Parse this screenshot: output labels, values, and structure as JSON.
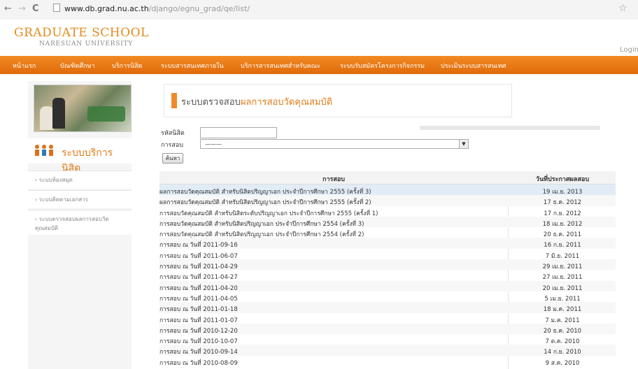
{
  "browser": {
    "url_domain": "www.db.grad.nu.ac.th",
    "url_path": "/django/egnu_grad/qe/list/",
    "back": "←",
    "forward": "→",
    "reload": "C",
    "star": "☆"
  },
  "header": {
    "logo_main": "GRADUATE SCHOOL",
    "logo_sub": "NARESUAN UNIVERSITY",
    "login": "Login"
  },
  "nav": {
    "items": [
      "หน้าแรก",
      "บัณฑิตศึกษา",
      "บริการนิสิต",
      "ระบบสารสนเทศภายใน",
      "บริการสารสนเทศสำหรับคณะ",
      "ระบบรับสมัครโครงการกิจกรรม",
      "ประเมินระบบสารสนเทศ"
    ]
  },
  "sidebar": {
    "service_title": "ระบบบริการนิสิต",
    "links": [
      "ระบบห้องสมุด",
      "ระบบติดตามเอกสาร",
      "ระบบตรวจสอบผลการสอบวัดคุณสมบัติ"
    ]
  },
  "main": {
    "title_prefix": "ระบบตรวจสอบ",
    "title_highlight": "ผลการสอบวัดคุณสมบัติ",
    "student_id_label": "รหัสนิสิต",
    "exam_label": "การสอบ",
    "exam_selected": "———",
    "search_button": "ค้นหา",
    "table_headers": [
      "การสอบ",
      "วันที่ประกาศผลสอบ"
    ],
    "rows": [
      [
        "ผลการสอบวัดคุณสมบัติ สำหรับนิสิตปริญญาเอก ประจำปีการศึกษา 2555 (ครั้งที่ 3)",
        "19 เม.ย. 2013"
      ],
      [
        "ผลการสอบวัดคุณสมบัติ สำหรับนิสิตปริญญาเอก ประจำปีการศึกษา 2555 (ครั้งที่ 2)",
        "17 ธ.ค. 2012"
      ],
      [
        "การสอบวัดคุณสมบัติ สำหรับนิสิตระดับปริญญาเอก ประจำปีการศึกษา 2555 (ครั้งที่ 1)",
        "17 ก.ย. 2012"
      ],
      [
        "การสอบวัดคุณสมบัติ สำหรับนิสิตปริญญาเอก ประจำปีการศึกษา 2554 (ครั้งที่ 3)",
        "18 เม.ย. 2012"
      ],
      [
        "การสอบวัดคุณสมบัติ สำหรับนิสิตปริญญาเอก ประจำปีการศึกษา 2554 (ครั้งที่ 2)",
        "20 ธ.ค. 2011"
      ],
      [
        "การสอบ ณ วันที่ 2011-09-16",
        "16 ก.ย. 2011"
      ],
      [
        "การสอบ ณ วันที่ 2011-06-07",
        "7 มิ.ย. 2011"
      ],
      [
        "การสอบ ณ วันที่ 2011-04-29",
        "29 เม.ย. 2011"
      ],
      [
        "การสอบ ณ วันที่ 2011-04-27",
        "27 เม.ย. 2011"
      ],
      [
        "การสอบ ณ วันที่ 2011-04-20",
        "20 เม.ย. 2011"
      ],
      [
        "การสอบ ณ วันที่ 2011-04-05",
        "5 เม.ย. 2011"
      ],
      [
        "การสอบ ณ วันที่ 2011-01-18",
        "18 ม.ค. 2011"
      ],
      [
        "การสอบ ณ วันที่ 2011-01-07",
        "7 ม.ค. 2011"
      ],
      [
        "การสอบ ณ วันที่ 2010-12-20",
        "20 ธ.ค. 2010"
      ],
      [
        "การสอบ ณ วันที่ 2010-10-07",
        "7 ต.ค. 2010"
      ],
      [
        "การสอบ ณ วันที่ 2010-09-14",
        "14 ก.ย. 2010"
      ],
      [
        "การสอบ ณ วันที่ 2010-08-09",
        "9 ส.ค. 2010"
      ]
    ]
  },
  "colors": {
    "nav": "#e8790f",
    "accent": "#e07b1a",
    "selected_row": "#e2ecf7"
  }
}
